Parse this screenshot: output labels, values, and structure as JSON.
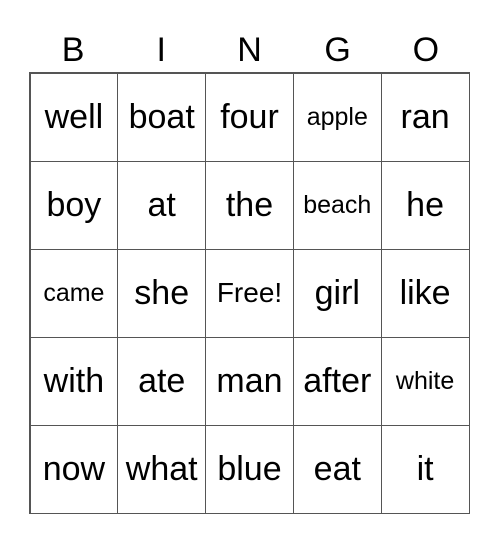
{
  "header": [
    "B",
    "I",
    "N",
    "G",
    "O"
  ],
  "rows": [
    [
      "well",
      "boat",
      "four",
      "apple",
      "ran"
    ],
    [
      "boy",
      "at",
      "the",
      "beach",
      "he"
    ],
    [
      "came",
      "she",
      "Free!",
      "girl",
      "like"
    ],
    [
      "with",
      "ate",
      "man",
      "after",
      "white"
    ],
    [
      "now",
      "what",
      "blue",
      "eat",
      "it"
    ]
  ]
}
